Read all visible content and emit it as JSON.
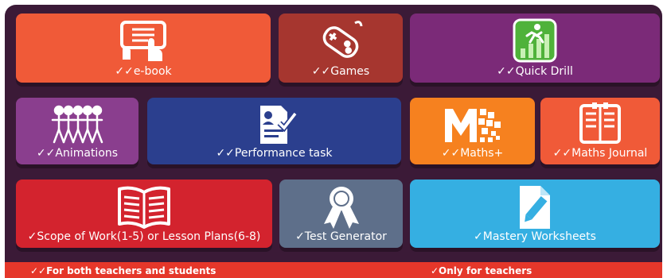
{
  "tiles": [
    {
      "id": "ebook",
      "label": "✓✓e-book",
      "color": "#f05a38",
      "icon": "tablet-touch-icon"
    },
    {
      "id": "games",
      "label": "✓✓Games",
      "color": "#a6362f",
      "icon": "gamepad-icon"
    },
    {
      "id": "quick_drill",
      "label": "✓✓Quick Drill",
      "color": "#7b2a78",
      "icon": "runner-chart-icon"
    },
    {
      "id": "animations",
      "label": "✓✓Animations",
      "color": "#8a3e8e",
      "icon": "stick-figures-icon"
    },
    {
      "id": "performance_task",
      "label": "✓✓Performance task",
      "color": "#2b3f8e",
      "icon": "resume-check-icon"
    },
    {
      "id": "maths_plus",
      "label": "✓✓Maths+",
      "color": "#f6811f",
      "icon": "maths-plus-logo-icon"
    },
    {
      "id": "maths_journal",
      "label": "✓✓Maths Journal",
      "color": "#f05a38",
      "icon": "journal-icon"
    },
    {
      "id": "scope_of_work",
      "label": "✓Scope of Work(1-5) or Lesson Plans(6-8)",
      "color": "#d3232e",
      "icon": "open-book-icon"
    },
    {
      "id": "test_generator",
      "label": "✓Test Generator",
      "color": "#5e6f8a",
      "icon": "ribbon-award-icon"
    },
    {
      "id": "mastery_worksheets",
      "label": "✓Mastery Worksheets",
      "color": "#35afe2",
      "icon": "worksheet-pencil-icon"
    }
  ],
  "footer": {
    "left_text": "✓✓For both teachers and students",
    "right_text": "✓Only for teachers"
  }
}
